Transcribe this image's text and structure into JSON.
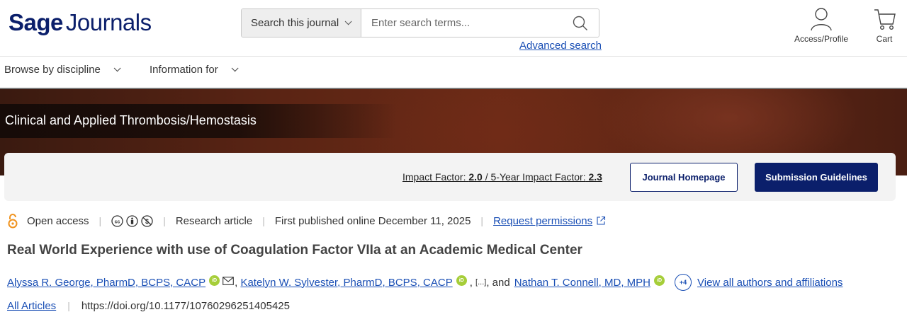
{
  "header": {
    "logo_bold": "Sage",
    "logo_light": "Journals",
    "search_scope_label": "Search this journal",
    "search_placeholder": "Enter search terms...",
    "advanced_search": "Advanced search",
    "access_label": "Access/Profile",
    "cart_label": "Cart"
  },
  "nav": {
    "items": [
      {
        "label": "Browse by discipline"
      },
      {
        "label": "Information for"
      }
    ]
  },
  "journal": {
    "title": "Clinical and Applied Thrombosis/Hemostasis",
    "impact_factor_label": "Impact Factor:",
    "impact_factor_value": "2.0",
    "five_year_label": "5-Year Impact Factor:",
    "five_year_value": "2.3",
    "homepage_button": "Journal Homepage",
    "submission_button": "Submission Guidelines"
  },
  "article": {
    "access": "Open access",
    "type": "Research article",
    "published": "First published online December 11, 2025",
    "permissions": "Request permissions",
    "title": "Real World Experience with use of Coagulation Factor VIIa at an Academic Medical Center",
    "authors": [
      "Alyssa R. George, PharmD, BCPS, CACP",
      "Katelyn W. Sylvester, PharmD, BCPS, CACP",
      "Nathan T. Connell, MD, MPH"
    ],
    "ellipsis": "[...]",
    "and_word": "and",
    "more_authors_badge": "+4",
    "view_all": "View all authors and affiliations",
    "all_articles": "All Articles",
    "doi": "https://doi.org/10.1177/10760296251405425"
  },
  "colors": {
    "brand_navy": "#0b1f6b",
    "link_blue": "#1a4fb5",
    "orcid_green": "#a6ce39",
    "open_access_orange": "#f0931f"
  }
}
